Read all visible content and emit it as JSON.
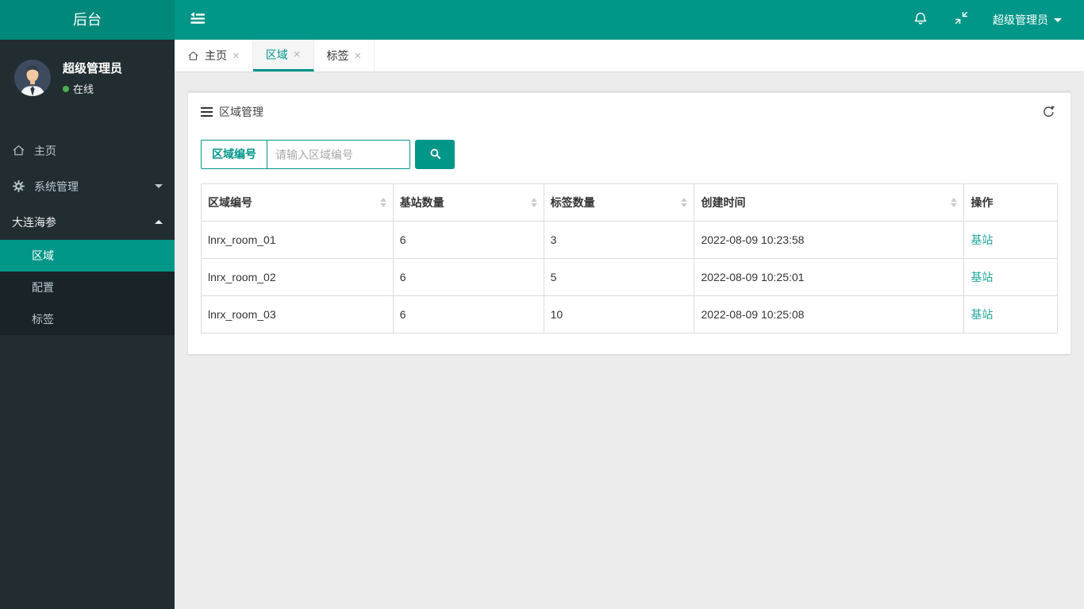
{
  "colors": {
    "teal": "#009688",
    "teal_dark": "#00897b",
    "sidebar_bg": "#222d32",
    "submenu_bg": "#1a2428",
    "link": "#26a69a",
    "online": "#4caf50",
    "content_bg": "#ececec"
  },
  "icons": {
    "close": "×",
    "sidebar_toggle": "fold-lines",
    "bell": "bell",
    "compress": "arrows-inward",
    "home": "house-outline",
    "gear": "cog",
    "hamburger": "three-bars",
    "refresh": "circular-arrow",
    "search": "magnifier",
    "sort": "up-down-triangles"
  },
  "navbar": {
    "brand": "后台",
    "user_label": "超级管理员"
  },
  "sidebar": {
    "user": {
      "name": "超级管理员",
      "status": "在线"
    },
    "items": [
      {
        "label": "主页",
        "icon": "home"
      },
      {
        "label": "系统管理",
        "icon": "gear",
        "caret": "down"
      },
      {
        "label": "大连海参",
        "caret": "up",
        "children": [
          {
            "label": "区域",
            "active": true
          },
          {
            "label": "配置"
          },
          {
            "label": "标签"
          }
        ]
      }
    ]
  },
  "tabs": [
    {
      "label": "主页",
      "icon": "home",
      "active": false
    },
    {
      "label": "区域",
      "active": true
    },
    {
      "label": "标签",
      "active": false
    }
  ],
  "panel": {
    "title": "区域管理",
    "search_label": "区域编号",
    "search_placeholder": "请输入区域编号"
  },
  "table": {
    "columns": [
      {
        "label": "区域编号",
        "sortable": true
      },
      {
        "label": "基站数量",
        "sortable": true
      },
      {
        "label": "标签数量",
        "sortable": true
      },
      {
        "label": "创建时间",
        "sortable": true
      },
      {
        "label": "操作",
        "sortable": false
      }
    ],
    "rows": [
      {
        "region": "lnrx_room_01",
        "stations": "6",
        "tags": "3",
        "created": "2022-08-09 10:23:58",
        "action": "基站"
      },
      {
        "region": "lnrx_room_02",
        "stations": "6",
        "tags": "5",
        "created": "2022-08-09 10:25:01",
        "action": "基站"
      },
      {
        "region": "lnrx_room_03",
        "stations": "6",
        "tags": "10",
        "created": "2022-08-09 10:25:08",
        "action": "基站"
      }
    ]
  }
}
